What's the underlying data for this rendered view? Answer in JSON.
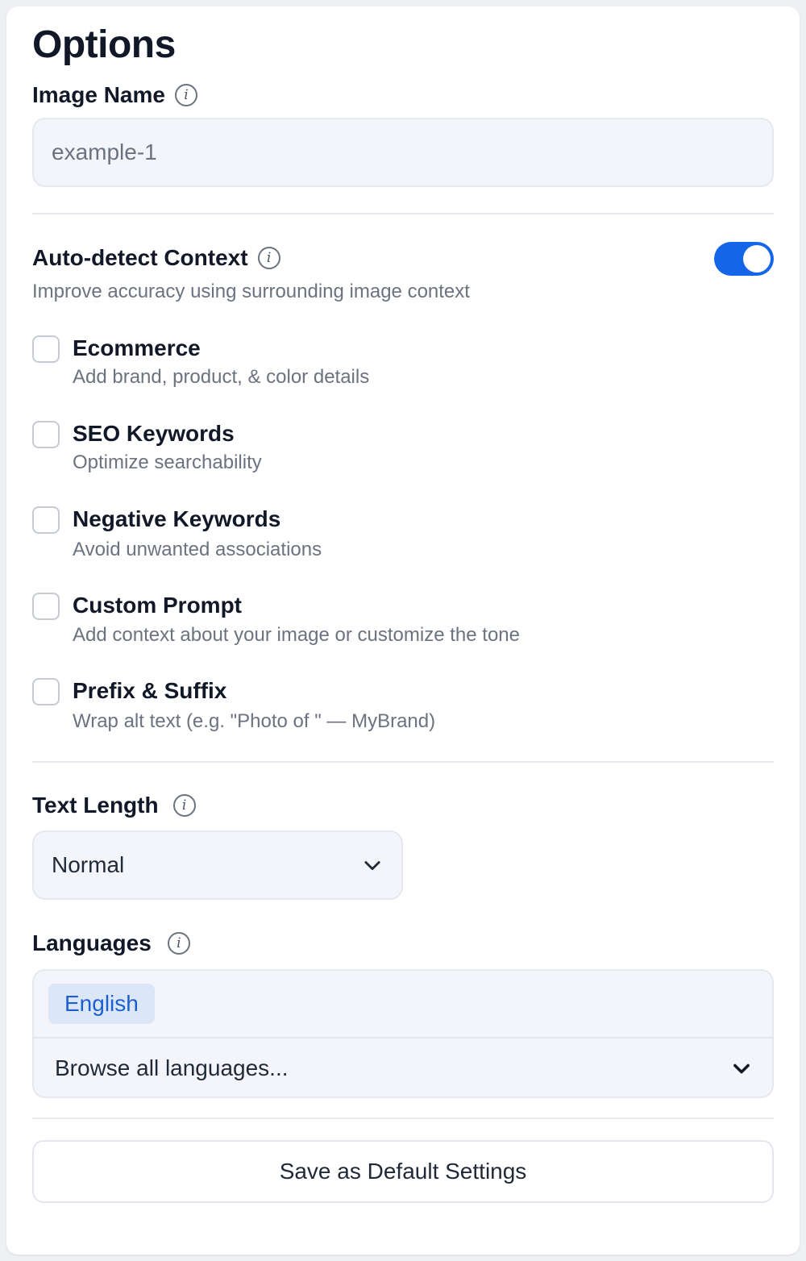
{
  "title": "Options",
  "image_name": {
    "label": "Image Name",
    "value": "example-1"
  },
  "auto_detect": {
    "label": "Auto-detect Context",
    "description": "Improve accuracy using surrounding image context",
    "enabled": true
  },
  "options": [
    {
      "title": "Ecommerce",
      "description": "Add brand, product, & color details",
      "checked": false
    },
    {
      "title": "SEO Keywords",
      "description": "Optimize searchability",
      "checked": false
    },
    {
      "title": "Negative Keywords",
      "description": "Avoid unwanted associations",
      "checked": false
    },
    {
      "title": "Custom Prompt",
      "description": "Add context about your image or customize the tone",
      "checked": false
    },
    {
      "title": "Prefix & Suffix",
      "description": "Wrap alt text (e.g. \"Photo of \" — MyBrand)",
      "checked": false
    }
  ],
  "text_length": {
    "label": "Text Length",
    "selected": "Normal"
  },
  "languages": {
    "label": "Languages",
    "selected": [
      "English"
    ],
    "browse_label": "Browse all languages..."
  },
  "save_button": "Save as Default Settings",
  "colors": {
    "accent": "#1565e8",
    "chip_bg": "#dbe7f7",
    "chip_text": "#1d5fd1"
  },
  "icons": {
    "info": "info-icon",
    "chevron": "chevron-down-icon"
  }
}
